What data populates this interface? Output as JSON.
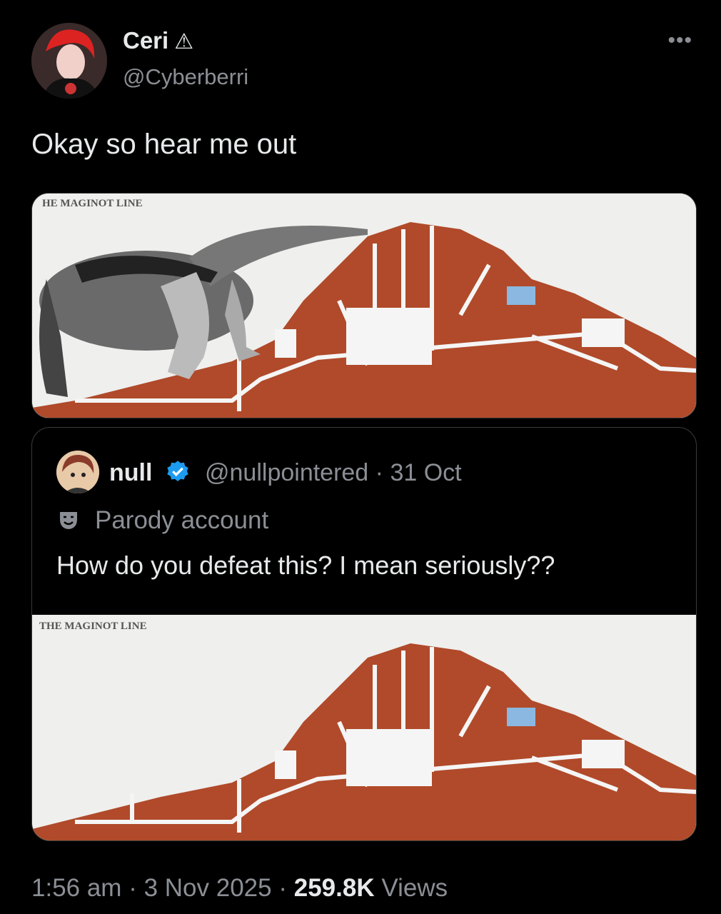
{
  "tweet": {
    "author_name": "Ceri",
    "author_badge": "⚠",
    "author_handle": "@Cyberberri",
    "more_icon": "•••",
    "text": "Okay so hear me out",
    "media_label": "HE MAGINOT LINE"
  },
  "quote": {
    "author_name": "null",
    "author_handle": "@nullpointered",
    "separator": "·",
    "date": "31 Oct",
    "parody_label": "Parody account",
    "text": "How do you defeat this? I mean seriously??",
    "media_label": "THE MAGINOT LINE"
  },
  "footer": {
    "time": "1:56 am",
    "sep1": "·",
    "date": "3 Nov 2025",
    "sep2": "·",
    "views_count": "259.8K",
    "views_label": "Views"
  },
  "colors": {
    "background": "#000000",
    "text": "#e7e9ea",
    "muted": "#8b8f95",
    "verified": "#1d9bf0",
    "earth": "#b04a2a",
    "sky": "#efefed"
  }
}
